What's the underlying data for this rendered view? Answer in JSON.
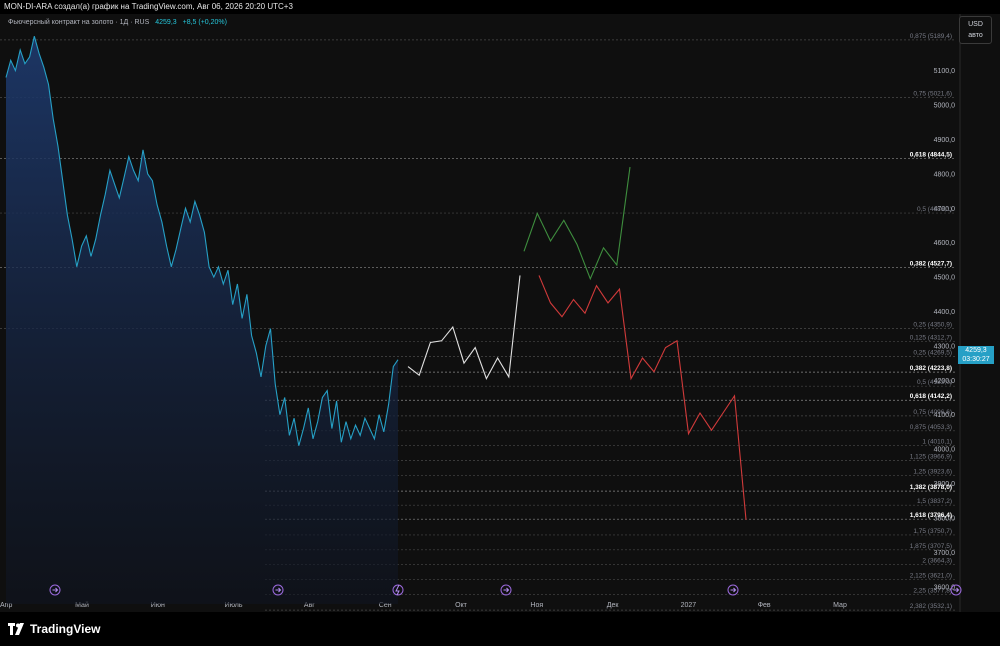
{
  "header": {
    "caption": "MON-DI-ARA создал(а) график на TradingView.com, Авг 06, 2026 20:20 UTC+3"
  },
  "legend": {
    "name": "Фьючерсный контракт на золото · 1Д · RUS",
    "value": "4259,3",
    "change": "+8,5 (+0,20%)"
  },
  "scale": {
    "currency": "USD",
    "mode": "авто"
  },
  "last_price": {
    "value": "4259,3",
    "timer": "03:30:27",
    "color": "#26a0c6"
  },
  "brand": {
    "name": "TradingView"
  },
  "chart_data": {
    "type": "line",
    "y_ticks": [
      "5100,0",
      "5000,0",
      "4900,0",
      "4800,0",
      "4700,0",
      "4600,0",
      "4500,0",
      "4400,0",
      "4300,0",
      "4200,0",
      "4100,0",
      "4000,0",
      "3900,0",
      "3800,0",
      "3700,0",
      "3600,0"
    ],
    "y_tick_values": [
      5100,
      5000,
      4900,
      4800,
      4700,
      4600,
      4500,
      4400,
      4300,
      4200,
      4100,
      4000,
      3900,
      3800,
      3700,
      3600
    ],
    "x_ticks": [
      "Апр",
      "Май",
      "Июн",
      "Июль",
      "Авг",
      "Сен",
      "Окт",
      "Ноя",
      "Дек",
      "2027",
      "Фев",
      "Мар"
    ],
    "fib_upper": [
      {
        "label": "0,875 (5189,4)",
        "value": 5189.4,
        "bold": false
      },
      {
        "label": "0,75 (5021,6)",
        "value": 5021.6,
        "bold": false
      },
      {
        "label": "0,618 (4844,5)",
        "value": 4844.5,
        "bold": true
      },
      {
        "label": "0,5 (4686,1)",
        "value": 4686.1,
        "bold": false
      },
      {
        "label": "0,382 (4527,7)",
        "value": 4527.7,
        "bold": true
      },
      {
        "label": "0,25 (4350,9)",
        "value": 4350.9,
        "bold": false
      }
    ],
    "fib_lower": [
      {
        "label": "0,125 (4312,7)",
        "value": 4312.7,
        "bold": false
      },
      {
        "label": "0,25 (4269,5)",
        "value": 4269.5,
        "bold": false
      },
      {
        "label": "0,382 (4223,8)",
        "value": 4223.8,
        "bold": true
      },
      {
        "label": "0,5 (4183,0)",
        "value": 4183.0,
        "bold": false
      },
      {
        "label": "0,618 (4142,2)",
        "value": 4142.2,
        "bold": true
      },
      {
        "label": "0,75 (4096,6)",
        "value": 4096.6,
        "bold": false
      },
      {
        "label": "0,875 (4053,3)",
        "value": 4053.3,
        "bold": false
      },
      {
        "label": "1 (4010,1)",
        "value": 4010.1,
        "bold": false
      },
      {
        "label": "1,125 (3966,9)",
        "value": 3966.9,
        "bold": false
      },
      {
        "label": "1,25 (3923,6)",
        "value": 3923.6,
        "bold": false
      },
      {
        "label": "1,382 (3878,0)",
        "value": 3878.0,
        "bold": true
      },
      {
        "label": "1,5 (3837,2)",
        "value": 3837.2,
        "bold": false
      },
      {
        "label": "1,618 (3796,4)",
        "value": 3796.4,
        "bold": true
      },
      {
        "label": "1,75 (3750,7)",
        "value": 3750.7,
        "bold": false
      },
      {
        "label": "1,875 (3707,5)",
        "value": 3707.5,
        "bold": false
      },
      {
        "label": "2 (3664,3)",
        "value": 3664.3,
        "bold": false
      },
      {
        "label": "2,125 (3621,0)",
        "value": 3621.0,
        "bold": false
      },
      {
        "label": "2,25 (3577,8)",
        "value": 3577.8,
        "bold": false
      },
      {
        "label": "2,382 (3532,1)",
        "value": 3532.1,
        "bold": false
      }
    ],
    "price_series": {
      "color": "#26a0c6",
      "values": [
        5080,
        5130,
        5100,
        5160,
        5120,
        5140,
        5200,
        5150,
        5110,
        5060,
        4960,
        4880,
        4780,
        4680,
        4610,
        4530,
        4590,
        4620,
        4560,
        4610,
        4680,
        4740,
        4810,
        4770,
        4730,
        4790,
        4850,
        4810,
        4780,
        4870,
        4800,
        4780,
        4710,
        4660,
        4590,
        4530,
        4580,
        4640,
        4700,
        4660,
        4720,
        4680,
        4630,
        4530,
        4500,
        4530,
        4480,
        4520,
        4420,
        4480,
        4380,
        4450,
        4330,
        4280,
        4210,
        4300,
        4350,
        4190,
        4100,
        4150,
        4040,
        4090,
        4010,
        4060,
        4120,
        4030,
        4080,
        4150,
        4170,
        4060,
        4140,
        4020,
        4080,
        4030,
        4070,
        4040,
        4090,
        4060,
        4030,
        4100,
        4050,
        4130,
        4240,
        4260
      ]
    },
    "projection_white": {
      "color": "#e0e0e0",
      "points": [
        [
          4250,
          4230
        ],
        [
          4220,
          4210
        ],
        [
          4300,
          4320
        ],
        [
          4290,
          4340
        ],
        [
          4370,
          4340
        ],
        [
          4260,
          4240
        ],
        [
          4290,
          4300
        ],
        [
          4200,
          4210
        ],
        [
          4260,
          4270
        ],
        [
          4200,
          4220
        ],
        [
          4500,
          4510
        ]
      ]
    },
    "projection_green": {
      "color": "#3e8e3e",
      "points": [
        [
          4570,
          4580
        ],
        [
          4680,
          4690
        ],
        [
          4600,
          4610
        ],
        [
          4660,
          4670
        ],
        [
          4600,
          4590
        ],
        [
          4500,
          4490
        ],
        [
          4580,
          4590
        ],
        [
          4540,
          4530
        ],
        [
          4820,
          4820
        ]
      ]
    },
    "projection_red": {
      "color": "#d03a3a",
      "points": [
        [
          4500,
          4510
        ],
        [
          4430,
          4420
        ],
        [
          4390,
          4380
        ],
        [
          4440,
          4430
        ],
        [
          4400,
          4390
        ],
        [
          4480,
          4470
        ],
        [
          4420,
          4430
        ],
        [
          4460,
          4470
        ],
        [
          4200,
          4210
        ],
        [
          4260,
          4270
        ],
        [
          4230,
          4220
        ],
        [
          4290,
          4300
        ],
        [
          4310,
          4320
        ],
        [
          4050,
          4040
        ],
        [
          4100,
          4110
        ],
        [
          4060,
          4050
        ],
        [
          4110,
          4100
        ],
        [
          4150,
          4160
        ],
        [
          3800,
          3790
        ]
      ]
    },
    "event_icons": [
      "earnings",
      "earnings",
      "dividend",
      "earnings",
      "earnings",
      "earnings"
    ],
    "ylim": [
      3550,
      5250
    ]
  }
}
